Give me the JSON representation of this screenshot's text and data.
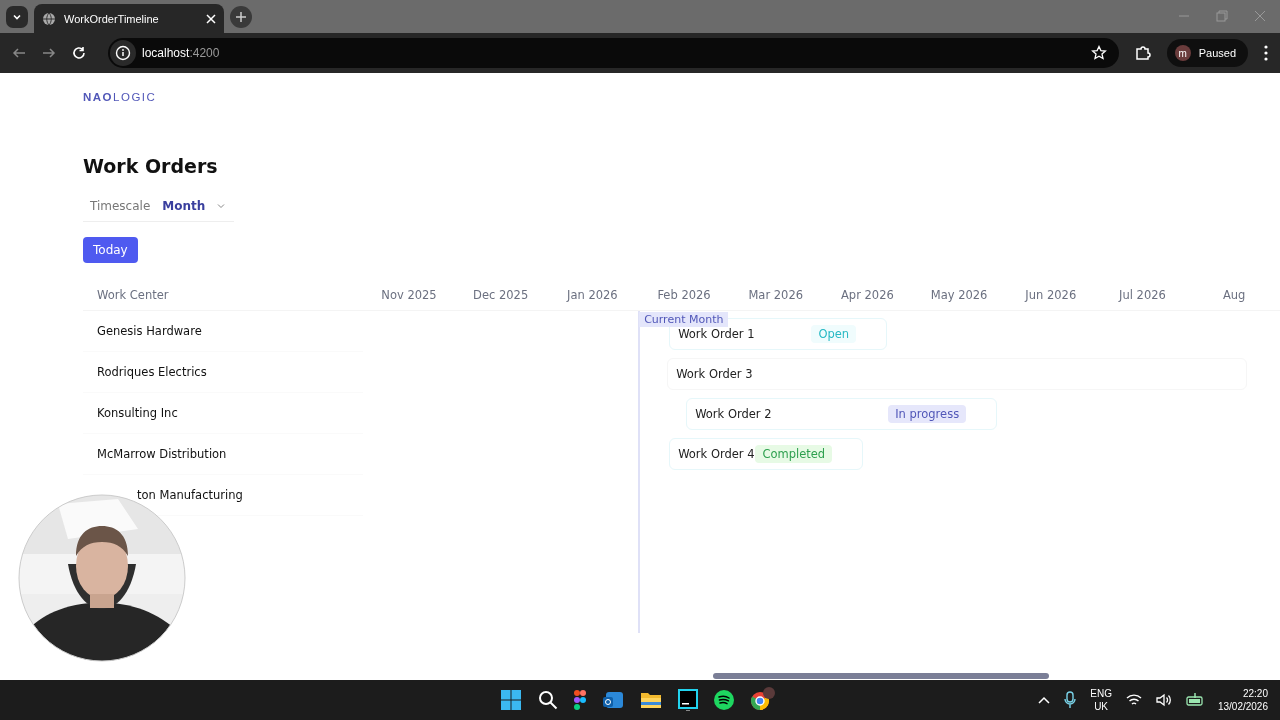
{
  "browser": {
    "tabs": [
      {
        "title": "WorkOrderTimeline",
        "selected": true
      }
    ],
    "address": {
      "host": "localhost",
      "port": ":4200"
    },
    "profile": {
      "initial": "m",
      "label": "Paused"
    }
  },
  "app": {
    "logo": "**NAO**LOGIC",
    "title": "Work Orders",
    "timescale": {
      "label": "Timescale",
      "value": "Month"
    },
    "today_button": "Today",
    "column_header": "Work Center",
    "months": [
      "Nov 2025",
      "Dec 2025",
      "Jan 2026",
      "Feb 2026",
      "Mar 2026",
      "Apr 2026",
      "May 2026",
      "Jun 2026",
      "Jul 2026",
      "Aug"
    ],
    "current_month_label": "Current Month",
    "work_centers": [
      {
        "name": "Genesis Hardware",
        "work_order": {
          "name": "Work Order 1",
          "status": {
            "label": "Open",
            "kind": "open"
          }
        }
      },
      {
        "name": "Rodriques Electrics",
        "work_order": {
          "name": "Work Order 3"
        }
      },
      {
        "name": "Konsulting Inc",
        "work_order": {
          "name": "Work Order 2",
          "status": {
            "label": "In progress",
            "kind": "in-progress"
          }
        }
      },
      {
        "name": "McMarrow Distribution",
        "work_order": {
          "name": "Work Order 4",
          "status": {
            "label": "Completed",
            "kind": "completed"
          }
        }
      },
      {
        "name": "ton Manufacturing"
      }
    ]
  },
  "taskbar": {
    "language": [
      "ENG",
      "UK"
    ],
    "time": "22:20",
    "date": "13/02/2026"
  }
}
